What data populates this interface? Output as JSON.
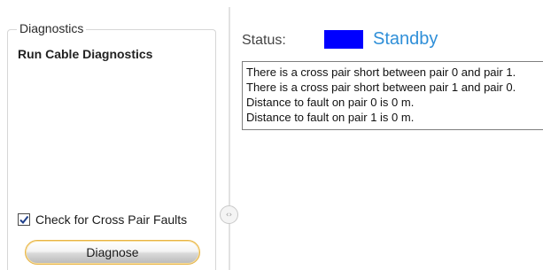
{
  "left_panel": {
    "group_title": "Diagnostics",
    "section_title": "Run Cable Diagnostics",
    "checkbox": {
      "label": "Check for Cross Pair Faults",
      "checked": true,
      "icon": "checkmark-icon"
    },
    "diagnose_button": {
      "label": "Diagnose"
    }
  },
  "splitter": {
    "icon": "expand-collapse-icon",
    "glyph": "‹›"
  },
  "right_panel": {
    "status_label": "Status:",
    "status_value": "Standby",
    "status_color": "#0000ff",
    "status_text_color": "#2f8fd8",
    "output_lines": [
      "There is a cross pair short between pair 0 and pair 1.",
      "There is a cross pair short between pair 1 and pair 0.",
      "Distance to fault on pair 0 is 0 m.",
      "Distance to fault on pair 1 is 0 m."
    ]
  }
}
